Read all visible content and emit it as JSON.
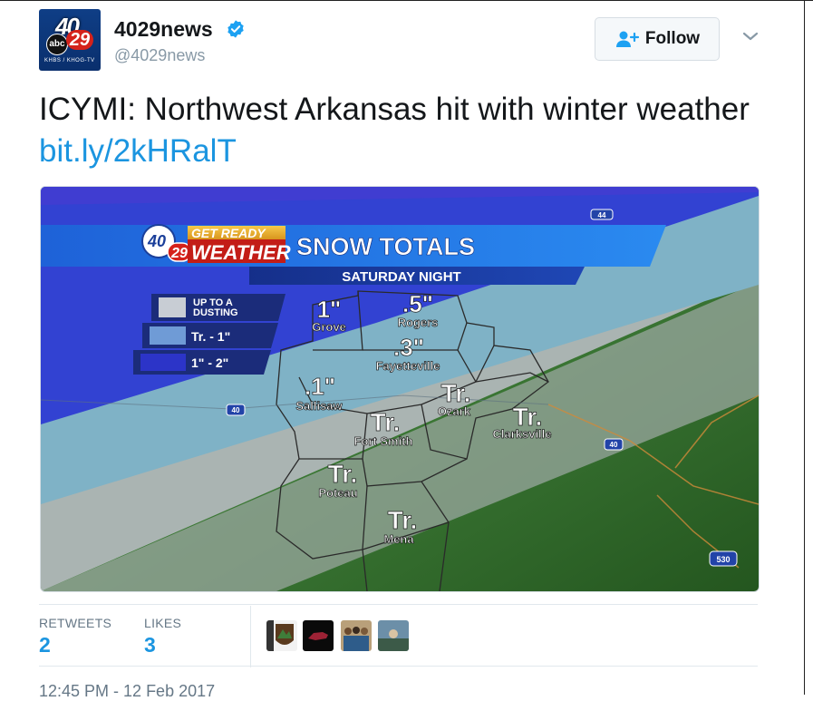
{
  "account": {
    "display_name": "4029news",
    "handle": "@4029news",
    "avatar_text": {
      "number": "40",
      "network": "abc",
      "channel": "29",
      "sub": "KHBS / KHOG-TV"
    }
  },
  "actions": {
    "follow_label": "Follow"
  },
  "tweet": {
    "text": "ICYMI: Northwest Arkansas hit with winter weather ",
    "link": "bit.ly/2kHRalT"
  },
  "image": {
    "brand_top": "GET READY",
    "brand_bottom": "WEATHER",
    "brand_num_top": "40",
    "brand_num_bottom": "29",
    "title": "SNOW TOTALS",
    "subtitle": "SATURDAY NIGHT",
    "legend": [
      {
        "label": "UP TO A",
        "label2": "DUSTING",
        "color": "#c8cdd4"
      },
      {
        "label": "Tr. - 1\"",
        "label2": "",
        "color": "#6f9bd6"
      },
      {
        "label": "1\" - 2\"",
        "label2": "",
        "color": "#2c34c8"
      }
    ],
    "cities": [
      {
        "amount": "1\"",
        "name": "Grove"
      },
      {
        "amount": ".5\"",
        "name": "Rogers"
      },
      {
        "amount": ".3\"",
        "name": "Fayetteville"
      },
      {
        "amount": ".1\"",
        "name": "Sallisaw"
      },
      {
        "amount": "Tr.",
        "name": "Ozark"
      },
      {
        "amount": "Tr.",
        "name": "Fort Smith"
      },
      {
        "amount": "Tr.",
        "name": "Clarksville"
      },
      {
        "amount": "Tr.",
        "name": "Poteau"
      },
      {
        "amount": "Tr.",
        "name": "Mena"
      }
    ],
    "highway_shields": [
      "44",
      "40",
      "40",
      "530"
    ]
  },
  "stats": {
    "retweets_label": "RETWEETS",
    "retweets": "2",
    "likes_label": "LIKES",
    "likes": "3"
  },
  "timestamp": "12:45 PM - 12 Feb 2017",
  "colors": {
    "link": "#1b95e0",
    "verified": "#1da1f2",
    "muted": "#8899a6"
  }
}
